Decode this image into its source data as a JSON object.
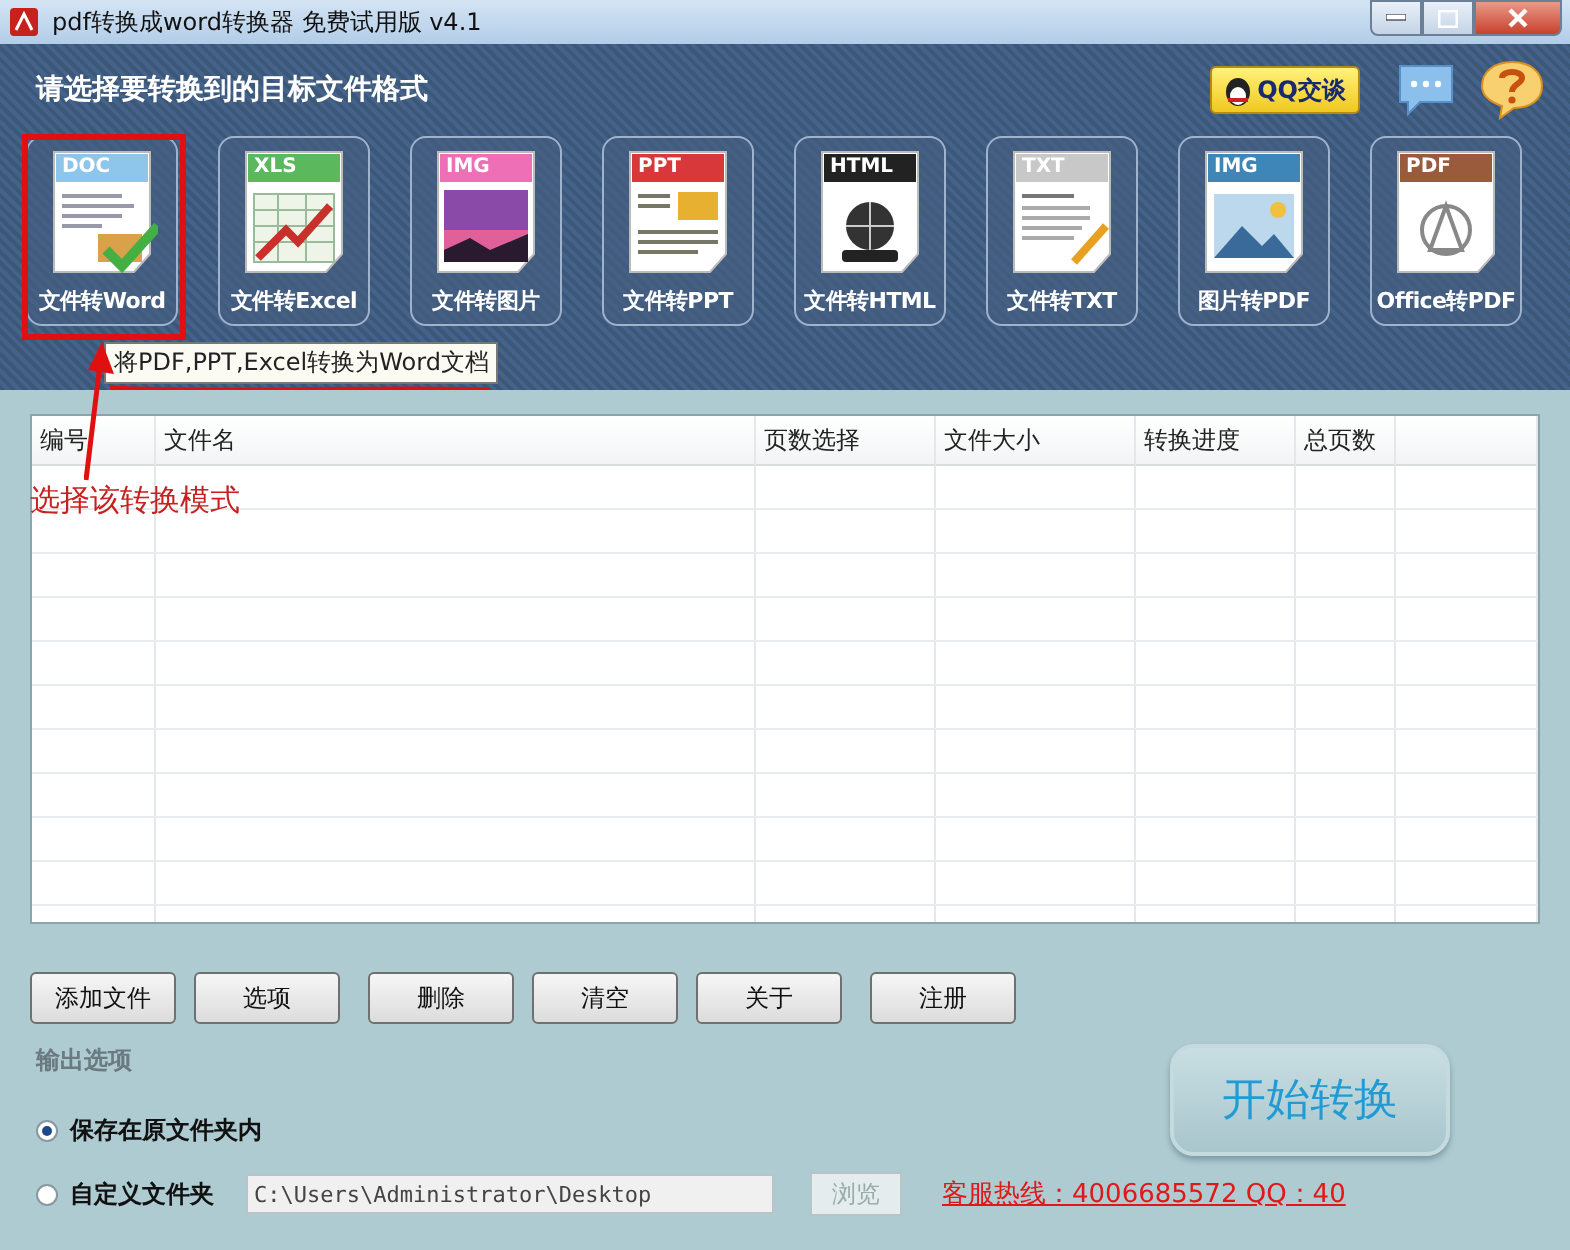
{
  "window": {
    "title": "pdf转换成word转换器 免费试用版 v4.1"
  },
  "header": {
    "title": "请选择要转换到的目标文件格式",
    "qq_button": "QQ交谈"
  },
  "formats": [
    {
      "badge": "DOC",
      "label": "文件转Word",
      "color": "#8ec5ea",
      "kind": "doc"
    },
    {
      "badge": "XLS",
      "label": "文件转Excel",
      "color": "#5cb85c",
      "kind": "xls"
    },
    {
      "badge": "IMG",
      "label": "文件转图片",
      "color": "#ee6fb5",
      "kind": "img"
    },
    {
      "badge": "PPT",
      "label": "文件转PPT",
      "color": "#d9383a",
      "kind": "ppt"
    },
    {
      "badge": "HTML",
      "label": "文件转HTML",
      "color": "#222222",
      "kind": "html"
    },
    {
      "badge": "TXT",
      "label": "文件转TXT",
      "color": "#c8c8c8",
      "kind": "txt"
    },
    {
      "badge": "IMG",
      "label": "图片转PDF",
      "color": "#3f86b8",
      "kind": "pic"
    },
    {
      "badge": "PDF",
      "label": "Office转PDF",
      "color": "#9a5a3c",
      "kind": "pdf"
    }
  ],
  "tooltip": "将PDF,PPT,Excel转换为Word文档",
  "table": {
    "columns": [
      "编号",
      "文件名",
      "页数选择",
      "文件大小",
      "转换进度",
      "总页数"
    ]
  },
  "buttons": [
    "添加文件",
    "选项",
    "删除",
    "清空",
    "关于",
    "注册"
  ],
  "output": {
    "title": "输出选项",
    "options": [
      {
        "label": "保存在原文件夹内",
        "selected": true
      },
      {
        "label": "自定义文件夹",
        "selected": false
      }
    ],
    "path": "C:\\Users\\Administrator\\Desktop",
    "browse": {
      "label": "浏览",
      "disabled": true
    }
  },
  "start_button": "开始转换",
  "hotline": "客服热线：4006685572 QQ：40",
  "annotation": {
    "text": "选择该转换模式"
  }
}
